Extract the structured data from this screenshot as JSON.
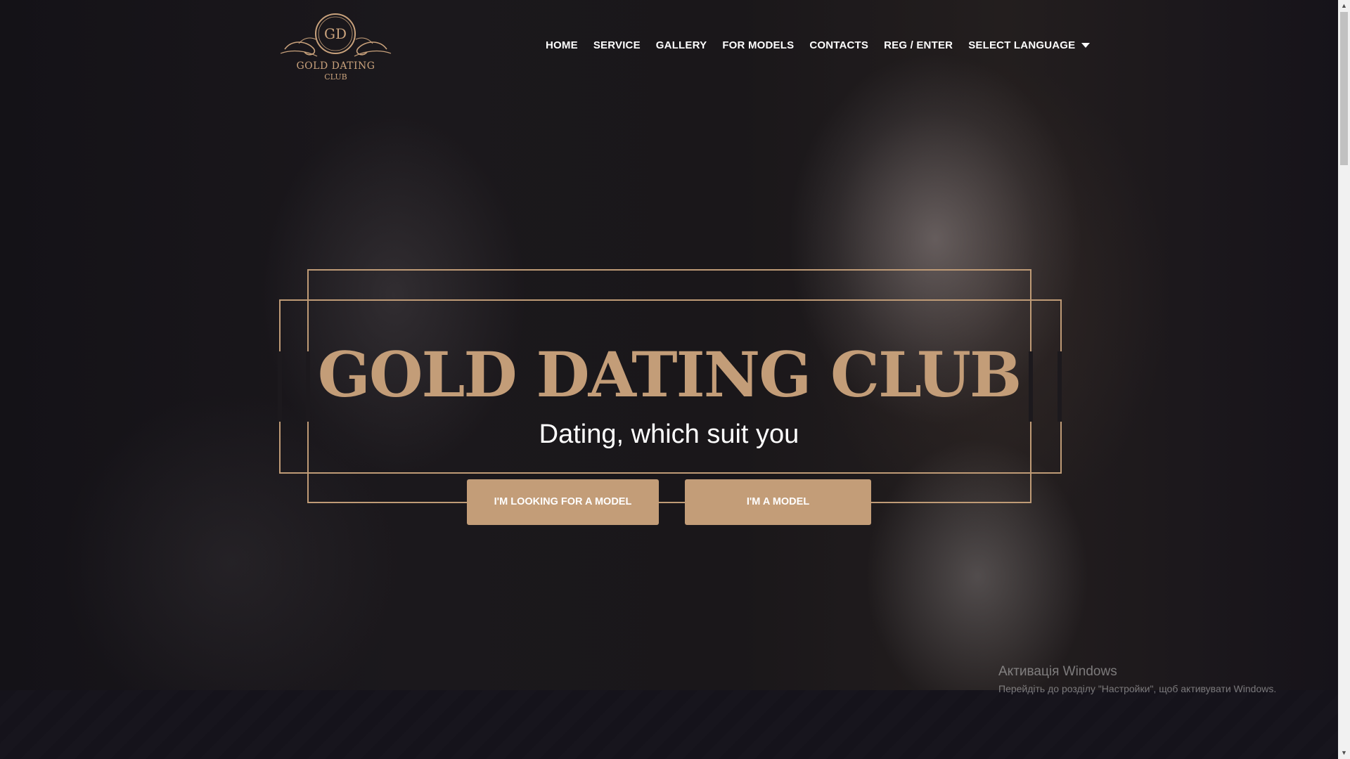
{
  "brand": {
    "logo_monogram": "GD",
    "logo_line1": "GOLD DATING",
    "logo_line2": "CLUB"
  },
  "nav": {
    "items": [
      "HOME",
      "SERVICE",
      "GALLERY",
      "FOR MODELS",
      "CONTACTS",
      "REG / ENTER"
    ],
    "language_label": "SELECT LANGUAGE"
  },
  "hero": {
    "title": "GOLD DATING CLUB",
    "subtitle": "Dating, which suit you",
    "button_seek": "I'M LOOKING FOR A MODEL",
    "button_model": "I'M A MODEL"
  },
  "watermark": {
    "title": "Активація Windows",
    "text": "Перейдіть до розділу \"Настройки\", щоб активувати Windows."
  },
  "colors": {
    "accent": "#c39d78",
    "background": "#121018",
    "text": "#ffffff"
  }
}
